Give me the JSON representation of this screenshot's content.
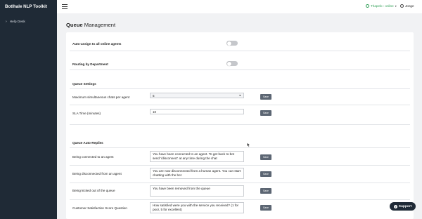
{
  "app": {
    "brand": "Botlhale NLP Toolkit"
  },
  "sidebar": {
    "items": [
      {
        "label": "Help Desk",
        "icon": "chevron-right-icon"
      }
    ]
  },
  "topbar": {
    "user_status": "Thapelo : online",
    "language": "Jonge"
  },
  "page": {
    "title_bold": "Queue",
    "title_rest": "Management"
  },
  "settings": {
    "auto_assign_label": "Auto-assign to all online agents",
    "routing_label": "Routing by Department",
    "queue_settings_title": "Queue Settings",
    "max_chats_label": "Maximum simultaneous chats per agent",
    "max_chats_value": "5",
    "sla_label": "SLA Time (minutes)",
    "sla_value": "10",
    "auto_replies_title": "Queue Auto-Replies",
    "connected_label": "Being connected to an agent",
    "connected_value": "You have been connected to an agent. To get back to bot send '/disconnect' at any time during the chat",
    "disconnected_label": "Being disconnected from an agent",
    "disconnected_value": "You are now disconnected from a human agent. You can start chatting with the bot",
    "kicked_label": "Being kicked out of the queue",
    "kicked_value": "You have been removed from the queue",
    "csat_label": "Customer Satisfaction Score Question",
    "csat_value": "How satisfied were you with the service you received? (1 for poor, 5 for excellent)",
    "save_label": "Save"
  },
  "support": {
    "label": "Support"
  },
  "colors": {
    "sidebar": "#1f2a36",
    "online": "#2e9e54",
    "save_button": "#5c6673",
    "toggle_off": "#c5c7cb"
  }
}
